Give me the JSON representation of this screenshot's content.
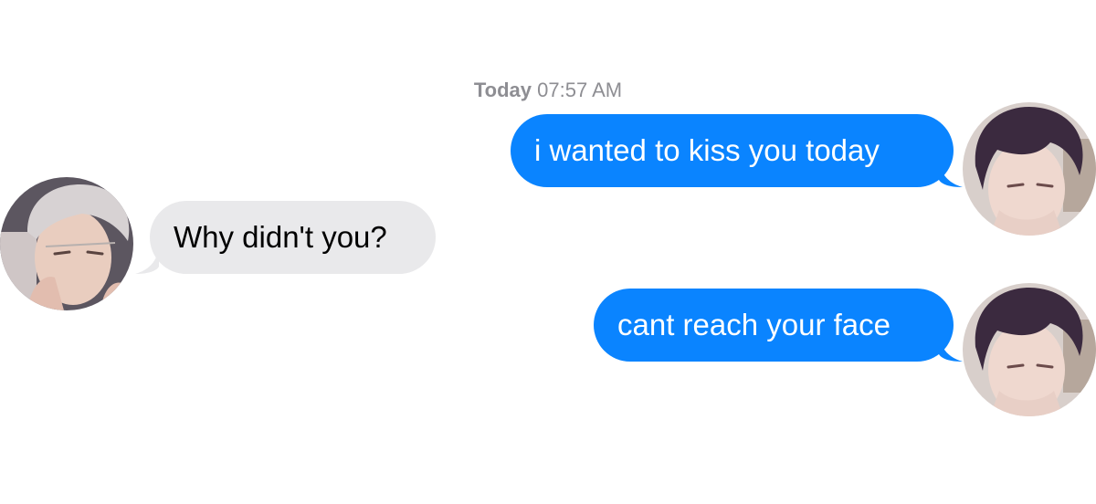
{
  "conversation": {
    "timestamp": {
      "day": "Today",
      "time": "07:57 AM"
    },
    "messages": [
      {
        "direction": "sent",
        "text": "i wanted to kiss you today"
      },
      {
        "direction": "received",
        "text": "Why didn't you?"
      },
      {
        "direction": "sent",
        "text": "cant reach your face"
      }
    ]
  },
  "colors": {
    "sent_bubble": "#0a84ff",
    "received_bubble": "#e9e9eb",
    "timestamp_text": "#8e8e93"
  },
  "avatars": {
    "sender": "avatar-dark-haired-character",
    "recipient": "avatar-silver-haired-character"
  }
}
